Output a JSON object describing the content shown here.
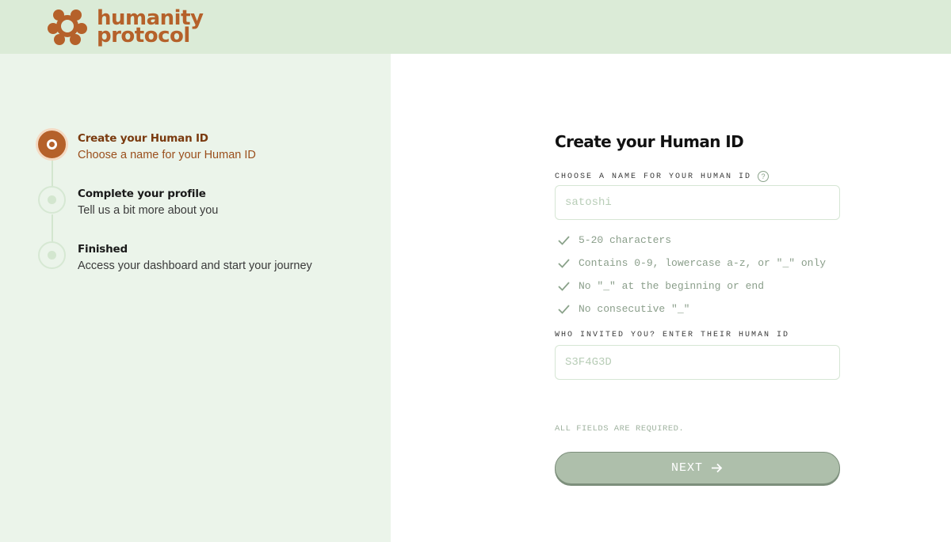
{
  "brand": {
    "name_line1": "humanity",
    "name_line2": "protocol",
    "color": "#b5612a"
  },
  "steps": [
    {
      "title": "Create your Human ID",
      "subtitle": "Choose a name for your Human ID",
      "state": "active"
    },
    {
      "title": "Complete your profile",
      "subtitle": "Tell us a bit more about you",
      "state": "pending"
    },
    {
      "title": "Finished",
      "subtitle": "Access your dashboard and start your journey",
      "state": "pending"
    }
  ],
  "form": {
    "title": "Create your Human ID",
    "human_id": {
      "label": "CHOOSE A NAME FOR YOUR HUMAN ID",
      "value": "",
      "placeholder": "satoshi",
      "help_icon": "question-circle-icon"
    },
    "rules": [
      "5-20 characters",
      "Contains 0-9, lowercase a-z, or \"_\" only",
      "No \"_\" at the beginning or end",
      "No consecutive \"_\""
    ],
    "inviter": {
      "label": "WHO INVITED YOU? ENTER THEIR HUMAN ID",
      "value": "",
      "placeholder": "S3F4G3D"
    },
    "required_note": "ALL FIELDS ARE REQUIRED.",
    "next_label": "NEXT"
  },
  "colors": {
    "header_bg": "#dbebd7",
    "left_panel_bg": "#ebf4ea",
    "button_bg": "#aebfab",
    "rule_text": "#8a9e8a"
  }
}
